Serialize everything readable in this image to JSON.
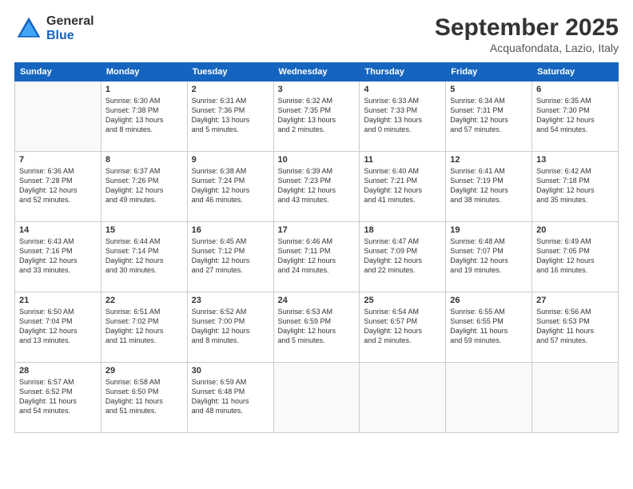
{
  "logo": {
    "general": "General",
    "blue": "Blue"
  },
  "header": {
    "month": "September 2025",
    "location": "Acquafondata, Lazio, Italy"
  },
  "days_header": [
    "Sunday",
    "Monday",
    "Tuesday",
    "Wednesday",
    "Thursday",
    "Friday",
    "Saturday"
  ],
  "weeks": [
    [
      {
        "day": "",
        "info": ""
      },
      {
        "day": "1",
        "info": "Sunrise: 6:30 AM\nSunset: 7:38 PM\nDaylight: 13 hours\nand 8 minutes."
      },
      {
        "day": "2",
        "info": "Sunrise: 6:31 AM\nSunset: 7:36 PM\nDaylight: 13 hours\nand 5 minutes."
      },
      {
        "day": "3",
        "info": "Sunrise: 6:32 AM\nSunset: 7:35 PM\nDaylight: 13 hours\nand 2 minutes."
      },
      {
        "day": "4",
        "info": "Sunrise: 6:33 AM\nSunset: 7:33 PM\nDaylight: 13 hours\nand 0 minutes."
      },
      {
        "day": "5",
        "info": "Sunrise: 6:34 AM\nSunset: 7:31 PM\nDaylight: 12 hours\nand 57 minutes."
      },
      {
        "day": "6",
        "info": "Sunrise: 6:35 AM\nSunset: 7:30 PM\nDaylight: 12 hours\nand 54 minutes."
      }
    ],
    [
      {
        "day": "7",
        "info": "Sunrise: 6:36 AM\nSunset: 7:28 PM\nDaylight: 12 hours\nand 52 minutes."
      },
      {
        "day": "8",
        "info": "Sunrise: 6:37 AM\nSunset: 7:26 PM\nDaylight: 12 hours\nand 49 minutes."
      },
      {
        "day": "9",
        "info": "Sunrise: 6:38 AM\nSunset: 7:24 PM\nDaylight: 12 hours\nand 46 minutes."
      },
      {
        "day": "10",
        "info": "Sunrise: 6:39 AM\nSunset: 7:23 PM\nDaylight: 12 hours\nand 43 minutes."
      },
      {
        "day": "11",
        "info": "Sunrise: 6:40 AM\nSunset: 7:21 PM\nDaylight: 12 hours\nand 41 minutes."
      },
      {
        "day": "12",
        "info": "Sunrise: 6:41 AM\nSunset: 7:19 PM\nDaylight: 12 hours\nand 38 minutes."
      },
      {
        "day": "13",
        "info": "Sunrise: 6:42 AM\nSunset: 7:18 PM\nDaylight: 12 hours\nand 35 minutes."
      }
    ],
    [
      {
        "day": "14",
        "info": "Sunrise: 6:43 AM\nSunset: 7:16 PM\nDaylight: 12 hours\nand 33 minutes."
      },
      {
        "day": "15",
        "info": "Sunrise: 6:44 AM\nSunset: 7:14 PM\nDaylight: 12 hours\nand 30 minutes."
      },
      {
        "day": "16",
        "info": "Sunrise: 6:45 AM\nSunset: 7:12 PM\nDaylight: 12 hours\nand 27 minutes."
      },
      {
        "day": "17",
        "info": "Sunrise: 6:46 AM\nSunset: 7:11 PM\nDaylight: 12 hours\nand 24 minutes."
      },
      {
        "day": "18",
        "info": "Sunrise: 6:47 AM\nSunset: 7:09 PM\nDaylight: 12 hours\nand 22 minutes."
      },
      {
        "day": "19",
        "info": "Sunrise: 6:48 AM\nSunset: 7:07 PM\nDaylight: 12 hours\nand 19 minutes."
      },
      {
        "day": "20",
        "info": "Sunrise: 6:49 AM\nSunset: 7:05 PM\nDaylight: 12 hours\nand 16 minutes."
      }
    ],
    [
      {
        "day": "21",
        "info": "Sunrise: 6:50 AM\nSunset: 7:04 PM\nDaylight: 12 hours\nand 13 minutes."
      },
      {
        "day": "22",
        "info": "Sunrise: 6:51 AM\nSunset: 7:02 PM\nDaylight: 12 hours\nand 11 minutes."
      },
      {
        "day": "23",
        "info": "Sunrise: 6:52 AM\nSunset: 7:00 PM\nDaylight: 12 hours\nand 8 minutes."
      },
      {
        "day": "24",
        "info": "Sunrise: 6:53 AM\nSunset: 6:59 PM\nDaylight: 12 hours\nand 5 minutes."
      },
      {
        "day": "25",
        "info": "Sunrise: 6:54 AM\nSunset: 6:57 PM\nDaylight: 12 hours\nand 2 minutes."
      },
      {
        "day": "26",
        "info": "Sunrise: 6:55 AM\nSunset: 6:55 PM\nDaylight: 11 hours\nand 59 minutes."
      },
      {
        "day": "27",
        "info": "Sunrise: 6:56 AM\nSunset: 6:53 PM\nDaylight: 11 hours\nand 57 minutes."
      }
    ],
    [
      {
        "day": "28",
        "info": "Sunrise: 6:57 AM\nSunset: 6:52 PM\nDaylight: 11 hours\nand 54 minutes."
      },
      {
        "day": "29",
        "info": "Sunrise: 6:58 AM\nSunset: 6:50 PM\nDaylight: 11 hours\nand 51 minutes."
      },
      {
        "day": "30",
        "info": "Sunrise: 6:59 AM\nSunset: 6:48 PM\nDaylight: 11 hours\nand 48 minutes."
      },
      {
        "day": "",
        "info": ""
      },
      {
        "day": "",
        "info": ""
      },
      {
        "day": "",
        "info": ""
      },
      {
        "day": "",
        "info": ""
      }
    ]
  ]
}
